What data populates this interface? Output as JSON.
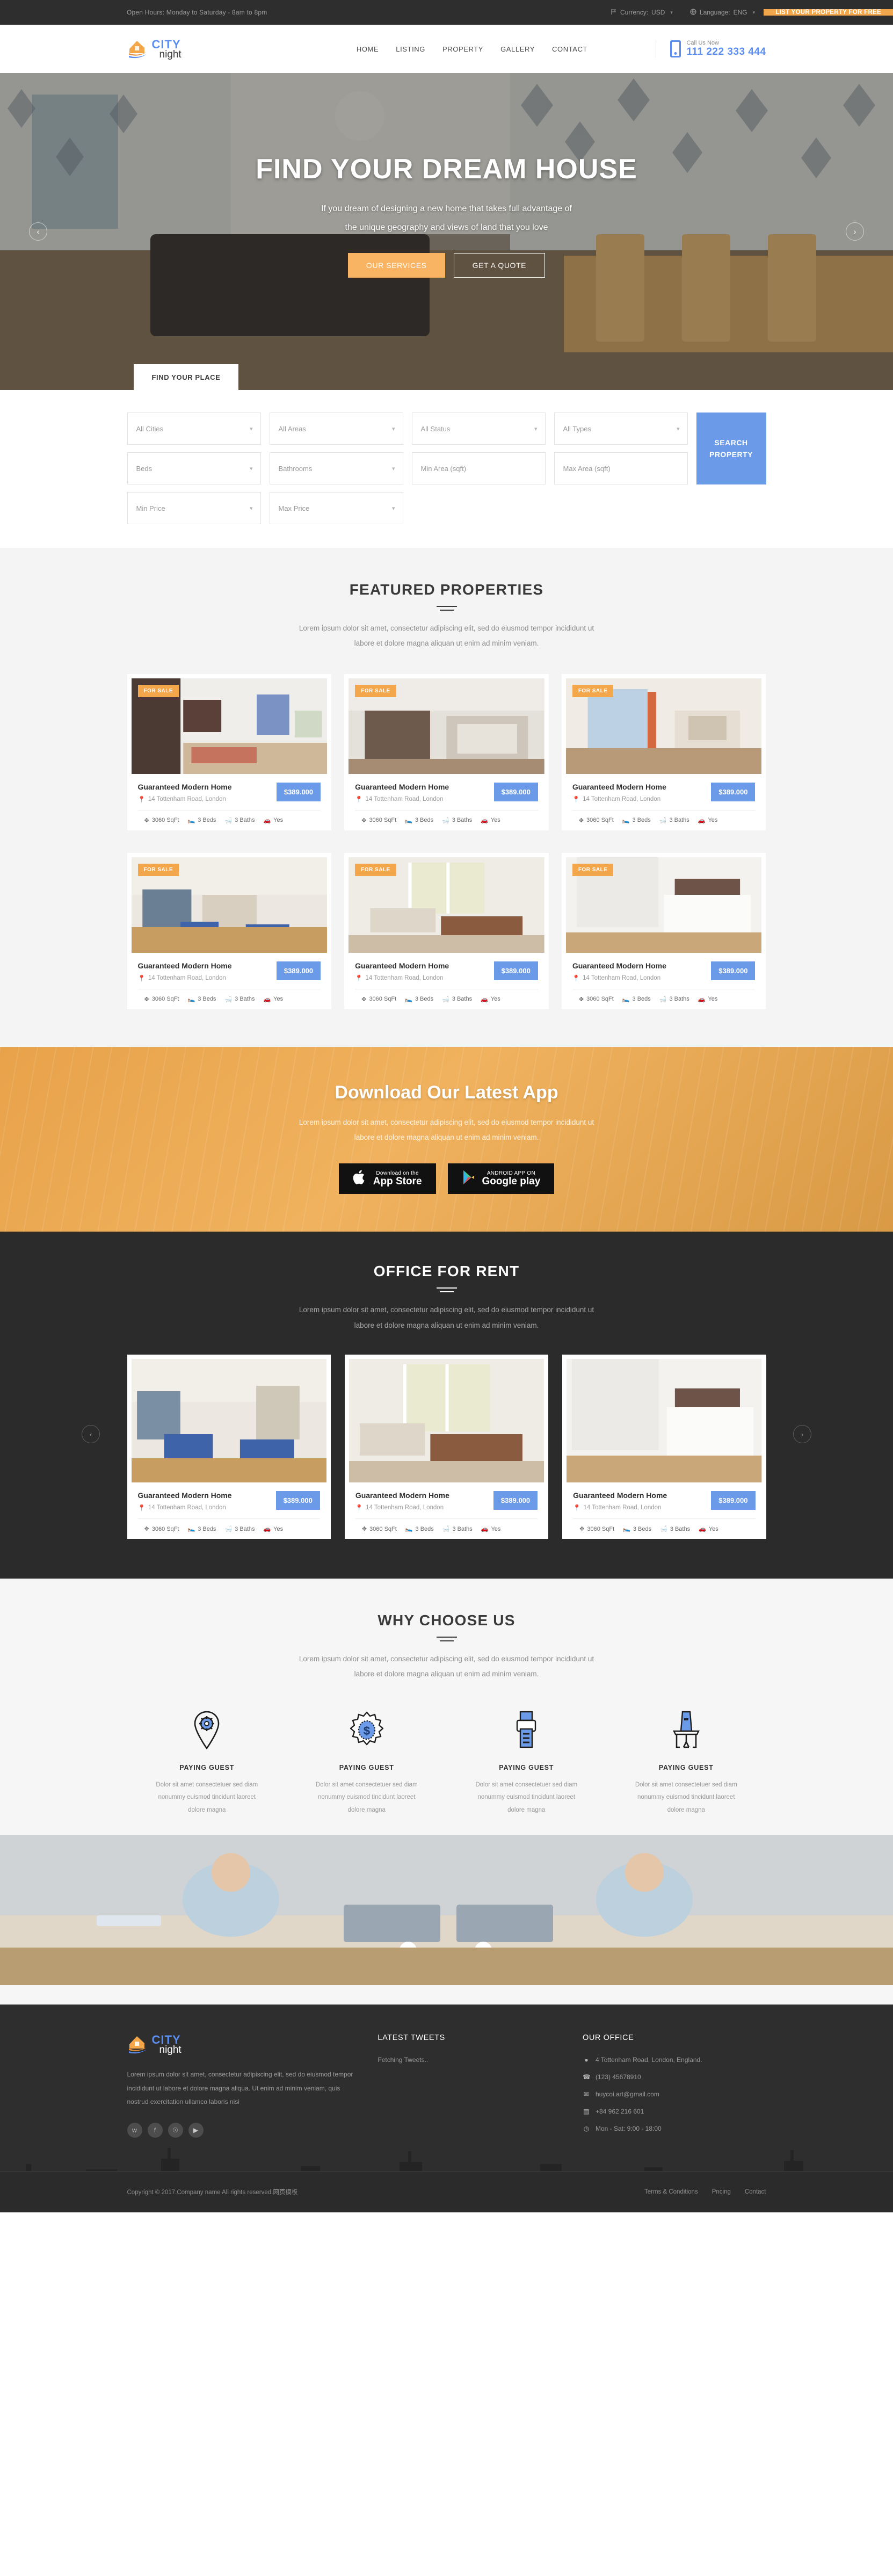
{
  "topbar": {
    "hours": "Open Hours: Monday to Saturday - 8am to 8pm",
    "currency_label": "Currency:",
    "currency_value": "USD",
    "language_label": "Language:",
    "language_value": "ENG",
    "cta": "LIST YOUR PROPERTY FOR FREE",
    "accent": "#f4a64a"
  },
  "header": {
    "logo_city": "CITY",
    "logo_night": "night",
    "nav": [
      "HOME",
      "LISTING",
      "PROPERTY",
      "GALLERY",
      "CONTACT"
    ],
    "call_label": "Call Us Now",
    "call_number": "111 222 333 444",
    "accent": "#5b8def"
  },
  "hero": {
    "title": "FIND YOUR DREAM HOUSE",
    "subtitle_line1": "If you dream of designing a new home that takes full advantage of",
    "subtitle_line2": "the unique geography and views of land that you love",
    "btn_primary": "OUR SERVICES",
    "btn_secondary": "GET A QUOTE",
    "prev": "‹",
    "next": "›"
  },
  "search": {
    "tab_label": "FIND YOUR PLACE",
    "fields": [
      {
        "label": "All Cities",
        "type": "select"
      },
      {
        "label": "All Areas",
        "type": "select"
      },
      {
        "label": "All Status",
        "type": "select"
      },
      {
        "label": "All Types",
        "type": "select"
      },
      {
        "label": "Beds",
        "type": "select"
      },
      {
        "label": "Bathrooms",
        "type": "select"
      },
      {
        "label": "Min Area (sqft)",
        "type": "text"
      },
      {
        "label": "Max Area (sqft)",
        "type": "text"
      },
      {
        "label": "Min Price",
        "type": "select"
      },
      {
        "label": "Max Price",
        "type": "select"
      }
    ],
    "button_line1": "SEARCH",
    "button_line2": "PROPERTY"
  },
  "featured": {
    "title": "FEATURED PROPERTIES",
    "desc_line1": "Lorem ipsum dolor sit amet, consectetur adipiscing elit, sed do eiusmod tempor incididunt ut",
    "desc_line2": "labore et dolore magna aliquan ut enim ad minim veniam.",
    "cards": [
      {
        "badge": "FOR SALE",
        "title": "Guaranteed Modern Home",
        "location": "14 Tottenham Road, London",
        "price": "$389.000",
        "sqft": "3060 SqFt",
        "beds": "3 Beds",
        "baths": "3 Baths",
        "garage": "Yes"
      },
      {
        "badge": "FOR SALE",
        "title": "Guaranteed Modern Home",
        "location": "14 Tottenham Road, London",
        "price": "$389.000",
        "sqft": "3060 SqFt",
        "beds": "3 Beds",
        "baths": "3 Baths",
        "garage": "Yes"
      },
      {
        "badge": "FOR SALE",
        "title": "Guaranteed Modern Home",
        "location": "14 Tottenham Road, London",
        "price": "$389.000",
        "sqft": "3060 SqFt",
        "beds": "3 Beds",
        "baths": "3 Baths",
        "garage": "Yes"
      },
      {
        "badge": "FOR SALE",
        "title": "Guaranteed Modern Home",
        "location": "14 Tottenham Road, London",
        "price": "$389.000",
        "sqft": "3060 SqFt",
        "beds": "3 Beds",
        "baths": "3 Baths",
        "garage": "Yes"
      },
      {
        "badge": "FOR SALE",
        "title": "Guaranteed Modern Home",
        "location": "14 Tottenham Road, London",
        "price": "$389.000",
        "sqft": "3060 SqFt",
        "beds": "3 Beds",
        "baths": "3 Baths",
        "garage": "Yes"
      },
      {
        "badge": "FOR SALE",
        "title": "Guaranteed Modern Home",
        "location": "14 Tottenham Road, London",
        "price": "$389.000",
        "sqft": "3060 SqFt",
        "beds": "3 Beds",
        "baths": "3 Baths",
        "garage": "Yes"
      }
    ]
  },
  "app": {
    "title": "Download Our Latest App",
    "desc_line1": "Lorem ipsum dolor sit amet, consectetur adipiscing elit, sed do eiusmod tempor incididunt ut",
    "desc_line2": "labore et dolore magna aliquan ut enim ad minim veniam.",
    "appstore_sub": "Download on the",
    "appstore_main": "App Store",
    "googleplay_sub": "ANDROID APP ON",
    "googleplay_main": "Google play"
  },
  "office": {
    "title": "OFFICE FOR RENT",
    "desc_line1": "Lorem ipsum dolor sit amet, consectetur adipiscing elit, sed do eiusmod tempor incididunt ut",
    "desc_line2": "labore et dolore magna aliquan ut enim ad minim veniam.",
    "prev": "‹",
    "next": "›",
    "cards": [
      {
        "title": "Guaranteed Modern Home",
        "location": "14 Tottenham Road, London",
        "price": "$389.000",
        "sqft": "3060 SqFt",
        "beds": "3 Beds",
        "baths": "3 Baths",
        "garage": "Yes"
      },
      {
        "title": "Guaranteed Modern Home",
        "location": "14 Tottenham Road, London",
        "price": "$389.000",
        "sqft": "3060 SqFt",
        "beds": "3 Beds",
        "baths": "3 Baths",
        "garage": "Yes"
      },
      {
        "title": "Guaranteed Modern Home",
        "location": "14 Tottenham Road, London",
        "price": "$389.000",
        "sqft": "3060 SqFt",
        "beds": "3 Beds",
        "baths": "3 Baths",
        "garage": "Yes"
      }
    ]
  },
  "why": {
    "title": "WHY CHOOSE US",
    "desc_line1": "Lorem ipsum dolor sit amet, consectetur adipiscing elit, sed do eiusmod tempor incididunt ut",
    "desc_line2": "labore et dolore magna aliquan ut enim ad minim veniam.",
    "features": [
      {
        "icon": "location-gear-icon",
        "title": "PAYING GUEST",
        "l1": "Dolor sit amet consectetuer sed diam",
        "l2": "nonummy euismod tincidunt laoreet",
        "l3": "dolore magna"
      },
      {
        "icon": "dollar-badge-icon",
        "title": "PAYING GUEST",
        "l1": "Dolor sit amet consectetuer sed diam",
        "l2": "nonummy euismod tincidunt laoreet",
        "l3": "dolore magna"
      },
      {
        "icon": "printer-icon",
        "title": "PAYING GUEST",
        "l1": "Dolor sit amet consectetuer sed diam",
        "l2": "nonummy euismod tincidunt laoreet",
        "l3": "dolore magna"
      },
      {
        "icon": "podium-icon",
        "title": "PAYING GUEST",
        "l1": "Dolor sit amet consectetuer sed diam",
        "l2": "nonummy euismod tincidunt laoreet",
        "l3": "dolore magna"
      }
    ]
  },
  "footer": {
    "logo_city": "CITY",
    "logo_night": "night",
    "about": "Lorem ipsum dolor sit amet, consectetur adipiscing elit, sed do eiusmod tempor incididunt ut labore et dolore magna aliqua. Ut enim ad minim veniam, quis nostrud exercitation ullamco laboris nisi",
    "socials": [
      "twitter-icon",
      "facebook-icon",
      "pinterest-icon",
      "youtube-icon"
    ],
    "tweets_title": "LATEST TWEETS",
    "tweets_body": "Fetching Tweets..",
    "office_title": "OUR OFFICE",
    "office_items": [
      {
        "icon": "map-pin-icon",
        "text": "4 Tottenham Road, London, England."
      },
      {
        "icon": "phone-icon",
        "text": "(123) 45678910"
      },
      {
        "icon": "envelope-icon",
        "text": "huycoi.art@gmail.com"
      },
      {
        "icon": "fax-icon",
        "text": "+84 962 216 601"
      },
      {
        "icon": "clock-icon",
        "text": "Mon - Sat: 9:00 - 18:00"
      }
    ],
    "copyright": "Copyright © 2017.Company name All rights reserved.网页模板",
    "links": [
      "Terms & Conditions",
      "Pricing",
      "Contact"
    ]
  }
}
